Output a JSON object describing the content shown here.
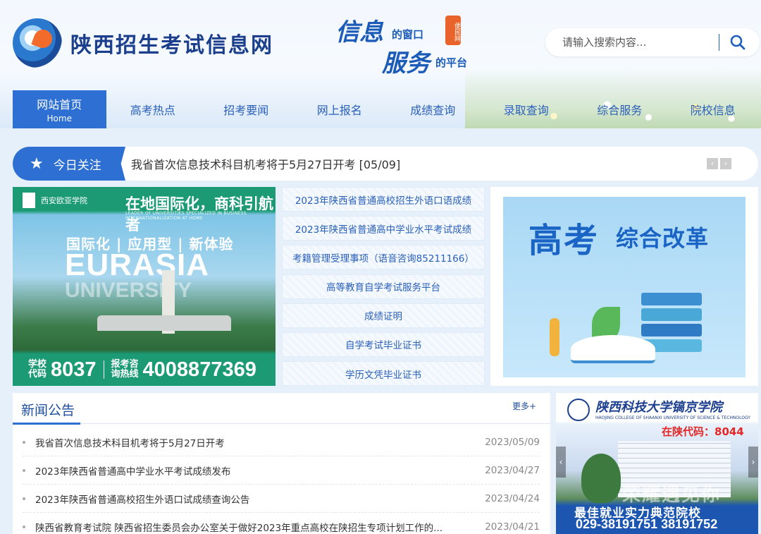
{
  "site": {
    "title": "陕西招生考试信息网",
    "slogan_line1_big": "信息",
    "slogan_line1_small": "的窗口",
    "slogan_line2_big": "服务",
    "slogan_line2_small": "的平台",
    "slogan_seal": "便民网"
  },
  "search": {
    "placeholder": "请输入搜索内容..."
  },
  "nav": {
    "items": [
      {
        "label": "网站首页",
        "sub": "Home"
      },
      {
        "label": "高考热点"
      },
      {
        "label": "招考要闻"
      },
      {
        "label": "网上报名"
      },
      {
        "label": "成绩查询"
      },
      {
        "label": "录取查询"
      },
      {
        "label": "综合服务"
      },
      {
        "label": "院校信息"
      }
    ]
  },
  "ticker": {
    "label": "今日关注",
    "text": "我省首次信息技术科目机考将于5月27日开考  [05/09]"
  },
  "banner_left": {
    "school": "西安欧亚学院",
    "headline": "在地国际化，商科引航者",
    "headline_en": "LEADER OF UNIVERSITIES SPECIALIZED IN BUSINESS INTERNATIONALIZATION AT HOME",
    "tagline": "国际化 | 应用型 | 新体验",
    "big1": "EURASIA",
    "big2": "UNIVERSITY",
    "code_label1": "学校",
    "code_label2": "代码",
    "code": "8037",
    "hotline_label1": "报考咨",
    "hotline_label2": "询热线",
    "hotline": "4008877369"
  },
  "links": [
    "2023年陕西省普通高校招生外语口语成绩",
    "2023年陕西省普通高中学业水平考试成绩",
    "考籍管理受理事项（语音咨询85211166）",
    "高等教育自学考试服务平台",
    "成绩证明",
    "自学考试毕业证书",
    "学历文凭毕业证书"
  ],
  "banner_right": {
    "title_big": "高考",
    "title_small": "综合改革"
  },
  "news": {
    "title": "新闻公告",
    "more": "更多+",
    "items": [
      {
        "text": "我省首次信息技术科目机考将于5月27日开考",
        "date": "2023/05/09"
      },
      {
        "text": "2023年陕西省普通高中学业水平考试成绩发布",
        "date": "2023/04/27"
      },
      {
        "text": "2023年陕西省普通高校招生外语口试成绩查询公告",
        "date": "2023/04/24"
      },
      {
        "text": "陕西省教育考试院 陕西省招生委员会办公室关于做好2023年重点高校在陕招生专项计划工作的...",
        "date": "2023/04/21"
      }
    ]
  },
  "ad": {
    "name": "陕西科技大学镐京学院",
    "name_en": "HAOJING COLLEGE OF SHAANXI UNIVERSITY OF SCIENCE & TECHNOLOGY",
    "code": "在陕代码：8044",
    "slogan": "最佳就业实力典范院校",
    "phone": "029-38191751  38191752",
    "watermark": "荣耀遇见你"
  },
  "colors": {
    "primary": "#2d6fd2",
    "title": "#1b3f8c",
    "link": "#2a5fb8"
  }
}
